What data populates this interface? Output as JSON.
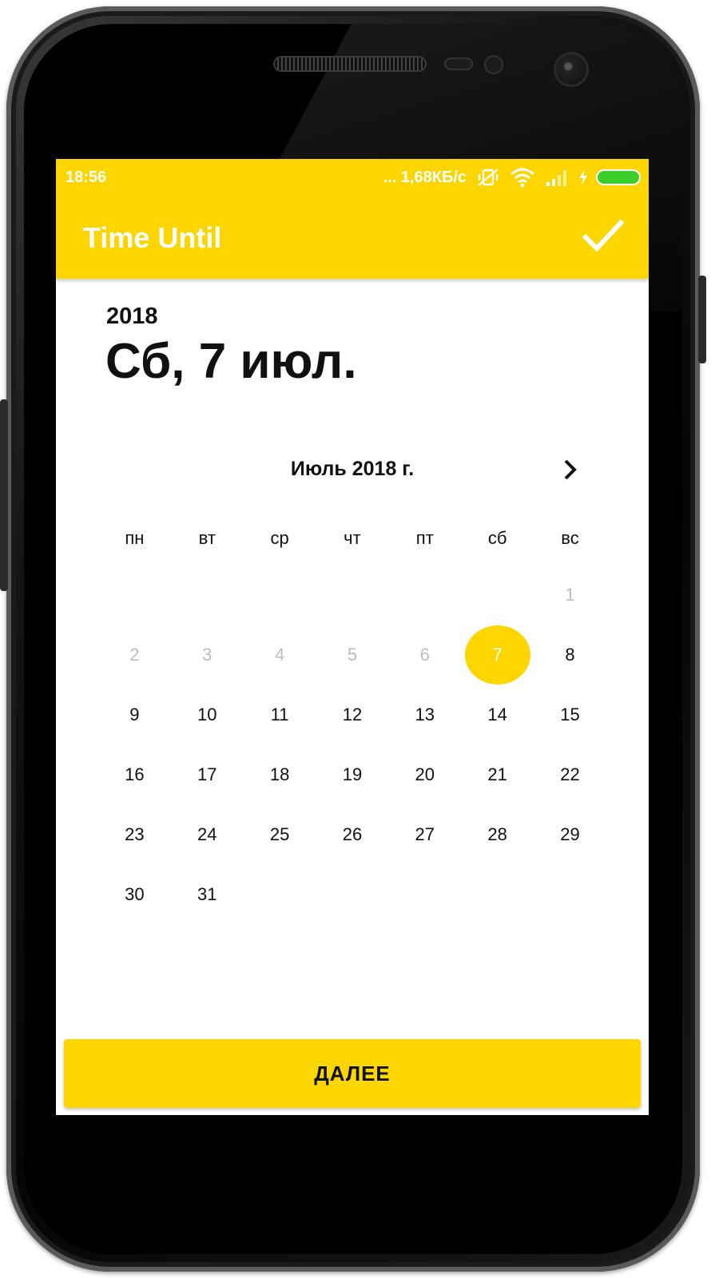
{
  "status_bar": {
    "time": "18:56",
    "network_speed": "... 1,68КБ/с",
    "icons": [
      "vibrate-off-icon",
      "wifi-icon",
      "signal-icon",
      "charging-icon",
      "battery-icon"
    ]
  },
  "app_bar": {
    "title": "Time Until",
    "confirm_icon": "check-icon"
  },
  "header": {
    "year": "2018",
    "date": "Сб, 7 июл."
  },
  "calendar": {
    "month_label": "Июль 2018 г.",
    "next_icon": "chevron-right-icon",
    "weekdays": [
      "пн",
      "вт",
      "ср",
      "чт",
      "пт",
      "сб",
      "вс"
    ],
    "weeks": [
      [
        "",
        "",
        "",
        "",
        "",
        "",
        "1"
      ],
      [
        "2",
        "3",
        "4",
        "5",
        "6",
        "7",
        "8"
      ],
      [
        "9",
        "10",
        "11",
        "12",
        "13",
        "14",
        "15"
      ],
      [
        "16",
        "17",
        "18",
        "19",
        "20",
        "21",
        "22"
      ],
      [
        "23",
        "24",
        "25",
        "26",
        "27",
        "28",
        "29"
      ],
      [
        "30",
        "31",
        "",
        "",
        "",
        "",
        ""
      ]
    ],
    "selected_day": "7",
    "disabled_days": [
      "1",
      "2",
      "3",
      "4",
      "5",
      "6"
    ]
  },
  "footer": {
    "next_label": "ДАЛЕЕ"
  },
  "colors": {
    "accent": "#fdd600",
    "text": "#111111",
    "muted": "#bdbdbd",
    "battery": "#3ccf2c"
  }
}
